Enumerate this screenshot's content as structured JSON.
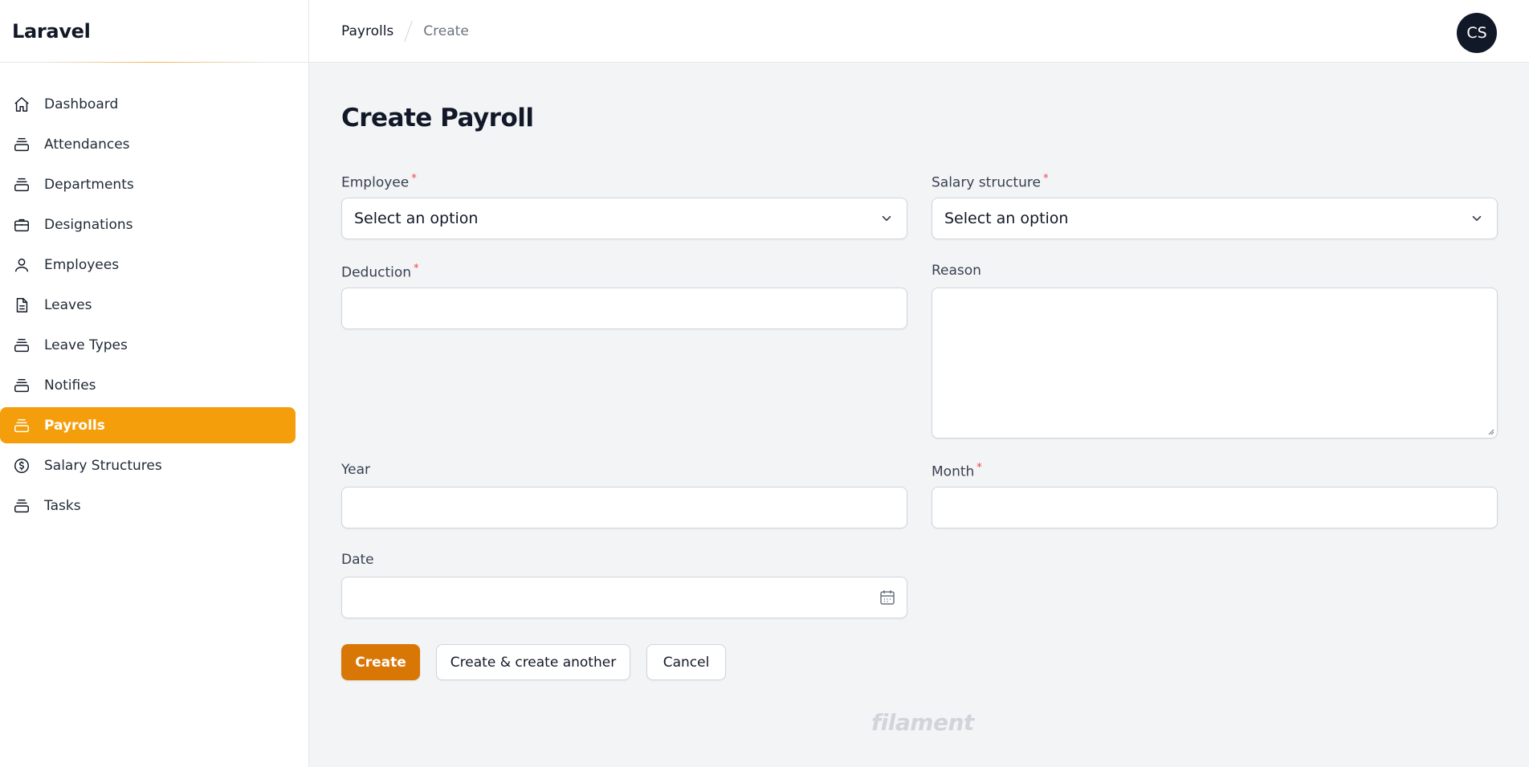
{
  "app": {
    "brand": "Laravel"
  },
  "sidebar": {
    "items": [
      {
        "label": "Dashboard",
        "icon": "home-icon",
        "active": false
      },
      {
        "label": "Attendances",
        "icon": "stack-icon",
        "active": false
      },
      {
        "label": "Departments",
        "icon": "stack-icon",
        "active": false
      },
      {
        "label": "Designations",
        "icon": "briefcase-icon",
        "active": false
      },
      {
        "label": "Employees",
        "icon": "user-icon",
        "active": false
      },
      {
        "label": "Leaves",
        "icon": "document-icon",
        "active": false
      },
      {
        "label": "Leave Types",
        "icon": "stack-icon",
        "active": false
      },
      {
        "label": "Notifies",
        "icon": "stack-icon",
        "active": false
      },
      {
        "label": "Payrolls",
        "icon": "stack-icon",
        "active": true
      },
      {
        "label": "Salary Structures",
        "icon": "dollar-circle-icon",
        "active": false
      },
      {
        "label": "Tasks",
        "icon": "stack-icon",
        "active": false
      }
    ]
  },
  "header": {
    "breadcrumb": [
      "Payrolls",
      "Create"
    ],
    "avatar_initials": "CS"
  },
  "page": {
    "title": "Create Payroll"
  },
  "form": {
    "employee": {
      "label": "Employee",
      "required": "*",
      "value": "Select an option"
    },
    "salary_structure": {
      "label": "Salary structure",
      "required": "*",
      "value": "Select an option"
    },
    "deduction": {
      "label": "Deduction",
      "required": "*",
      "value": ""
    },
    "reason": {
      "label": "Reason",
      "value": ""
    },
    "year": {
      "label": "Year",
      "value": ""
    },
    "month": {
      "label": "Month",
      "required": "*",
      "value": ""
    },
    "date": {
      "label": "Date",
      "value": ""
    }
  },
  "actions": {
    "create": "Create",
    "create_another": "Create & create another",
    "cancel": "Cancel"
  },
  "footer": {
    "logo": "filament"
  },
  "colors": {
    "primary": "#f59e0b",
    "primary_button": "#d97706",
    "required": "#ef4444",
    "avatar_bg": "#111827"
  }
}
